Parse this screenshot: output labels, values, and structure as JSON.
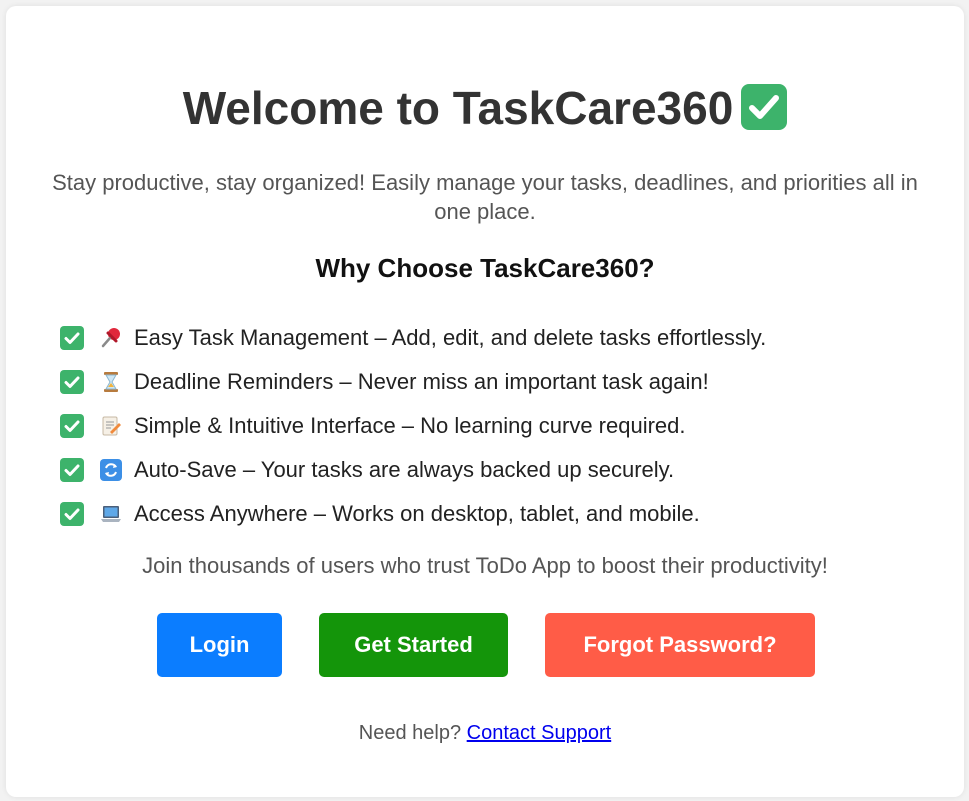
{
  "header": {
    "title": "Welcome to TaskCare360",
    "title_icon": "check-mark-button-emoji",
    "subtitle": "Stay productive, stay organized! Easily manage your tasks, deadlines, and priorities all in one place."
  },
  "features": {
    "heading": "Why Choose TaskCare360?",
    "items": [
      {
        "icon": "pushpin-icon",
        "text": "Easy Task Management – Add, edit, and delete tasks effortlessly."
      },
      {
        "icon": "hourglass-icon",
        "text": "Deadline Reminders – Never miss an important task again!"
      },
      {
        "icon": "memo-icon",
        "text": "Simple & Intuitive Interface – No learning curve required."
      },
      {
        "icon": "refresh-icon",
        "text": "Auto-Save – Your tasks are always backed up securely."
      },
      {
        "icon": "laptop-icon",
        "text": "Access Anywhere – Works on desktop, tablet, and mobile."
      }
    ]
  },
  "cta": {
    "tagline": "Join thousands of users who trust ToDo App to boost their productivity!",
    "login_label": "Login",
    "get_started_label": "Get Started",
    "forgot_label": "Forgot Password?"
  },
  "footer": {
    "help_text": "Need help?",
    "support_link": "Contact Support"
  },
  "colors": {
    "login": "#0b7dff",
    "get_started": "#14950a",
    "forgot": "#ff5c47",
    "check": "#3db36b"
  }
}
